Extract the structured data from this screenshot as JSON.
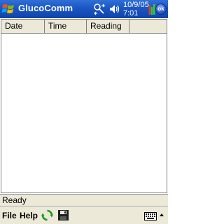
{
  "title_bar": {
    "app_title": "GlucoComm",
    "clock_date": "10/9/05",
    "clock_time": "7:01",
    "ok_label": "ok"
  },
  "list": {
    "columns": [
      "Date",
      "Time",
      "Reading",
      ""
    ],
    "rows": []
  },
  "status": {
    "text": "Ready"
  },
  "command_bar": {
    "menus": [
      "File",
      "Help"
    ],
    "icons": [
      "refresh-icon",
      "save-icon",
      "keyboard-icon"
    ]
  }
}
